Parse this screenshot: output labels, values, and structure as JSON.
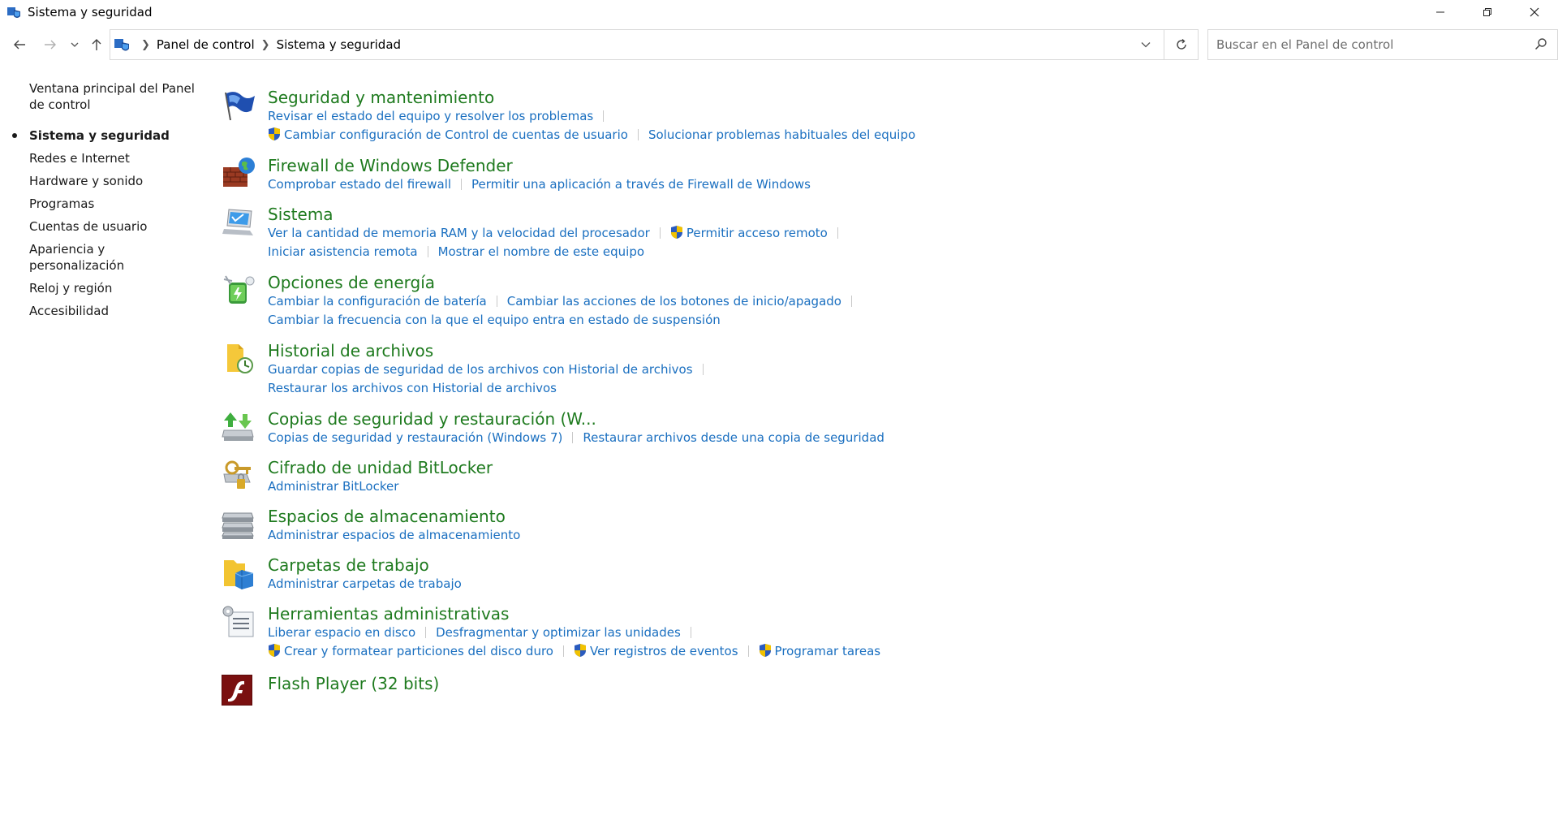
{
  "window": {
    "title": "Sistema y seguridad"
  },
  "nav": {
    "breadcrumbs": [
      "Panel de control",
      "Sistema y seguridad"
    ],
    "search_placeholder": "Buscar en el Panel de control"
  },
  "sidebar": {
    "items": [
      {
        "label": "Ventana principal del Panel de control"
      },
      {
        "label": "Sistema y seguridad"
      },
      {
        "label": "Redes e Internet"
      },
      {
        "label": "Hardware y sonido"
      },
      {
        "label": "Programas"
      },
      {
        "label": "Cuentas de usuario"
      },
      {
        "label": "Apariencia y personalización"
      },
      {
        "label": "Reloj y región"
      },
      {
        "label": "Accesibilidad"
      }
    ]
  },
  "categories": [
    {
      "title": "Seguridad y mantenimiento",
      "icon": "flag-icon",
      "lines": [
        [
          "Revisar el estado del equipo y resolver los problemas"
        ],
        [
          "Cambiar configuración de Control de cuentas de usuario",
          "Solucionar problemas habituales del equipo"
        ]
      ]
    },
    {
      "title": "Firewall de Windows Defender",
      "icon": "firewall-icon",
      "lines": [
        [
          "Comprobar estado del firewall",
          "Permitir una aplicación a través de Firewall de Windows"
        ]
      ]
    },
    {
      "title": "Sistema",
      "icon": "computer-icon",
      "lines": [
        [
          "Ver la cantidad de memoria RAM y la velocidad del procesador",
          "Permitir acceso remoto"
        ],
        [
          "Iniciar asistencia remota",
          "Mostrar el nombre de este equipo"
        ]
      ]
    },
    {
      "title": "Opciones de energía",
      "icon": "power-icon",
      "lines": [
        [
          "Cambiar la configuración de batería",
          "Cambiar las acciones de los botones de inicio/apagado"
        ],
        [
          "Cambiar la frecuencia con la que el equipo entra en estado de suspensión"
        ]
      ]
    },
    {
      "title": "Historial de archivos",
      "icon": "file-history-icon",
      "lines": [
        [
          "Guardar copias de seguridad de los archivos con Historial de archivos"
        ],
        [
          "Restaurar los archivos con Historial de archivos"
        ]
      ]
    },
    {
      "title": "Copias de seguridad y restauración (W...",
      "icon": "backup-icon",
      "lines": [
        [
          "Copias de seguridad y restauración (Windows 7)",
          "Restaurar archivos desde una copia de seguridad"
        ]
      ]
    },
    {
      "title": "Cifrado de unidad BitLocker",
      "icon": "bitlocker-icon",
      "lines": [
        [
          "Administrar BitLocker"
        ]
      ]
    },
    {
      "title": "Espacios de almacenamiento",
      "icon": "storage-icon",
      "lines": [
        [
          "Administrar espacios de almacenamiento"
        ]
      ]
    },
    {
      "title": "Carpetas de trabajo",
      "icon": "work-folders-icon",
      "lines": [
        [
          "Administrar carpetas de trabajo"
        ]
      ]
    },
    {
      "title": "Herramientas administrativas",
      "icon": "admin-tools-icon",
      "lines": [
        [
          "Liberar espacio en disco",
          "Desfragmentar y optimizar las unidades"
        ],
        [
          "Crear y formatear particiones del disco duro",
          "Ver registros de eventos",
          "Programar tareas"
        ]
      ]
    },
    {
      "title": "Flash Player (32 bits)",
      "icon": "flash-icon",
      "lines": []
    }
  ]
}
